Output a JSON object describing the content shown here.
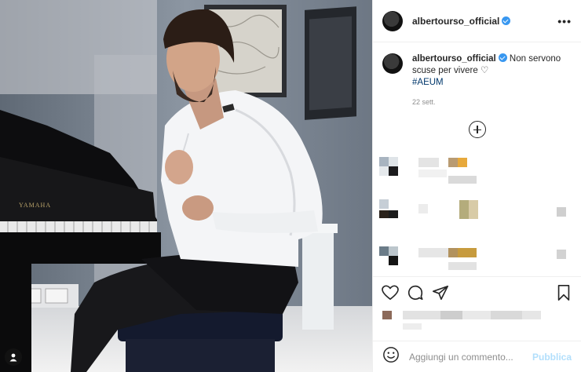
{
  "post": {
    "username": "albertourso_official",
    "more_label": "•••"
  },
  "caption": {
    "username": "albertourso_official",
    "text": "Non servono scuse per vivere",
    "emoji": "♡",
    "hashtag": "#AEUM",
    "date": "22 sett."
  },
  "photo": {
    "piano_brand": "YAMAHA"
  },
  "comment_box": {
    "placeholder": "Aggiungi un commento...",
    "publish_label": "Pubblica"
  },
  "colors": {
    "accent": "#3897f0",
    "publish": "#b2dffc",
    "text": "#262626",
    "muted": "#8e8e8e"
  },
  "icons": [
    "heart-icon",
    "comment-icon",
    "share-icon",
    "bookmark-icon",
    "emoji-icon",
    "load-more-icon",
    "user-tag-icon",
    "more-options-icon"
  ]
}
